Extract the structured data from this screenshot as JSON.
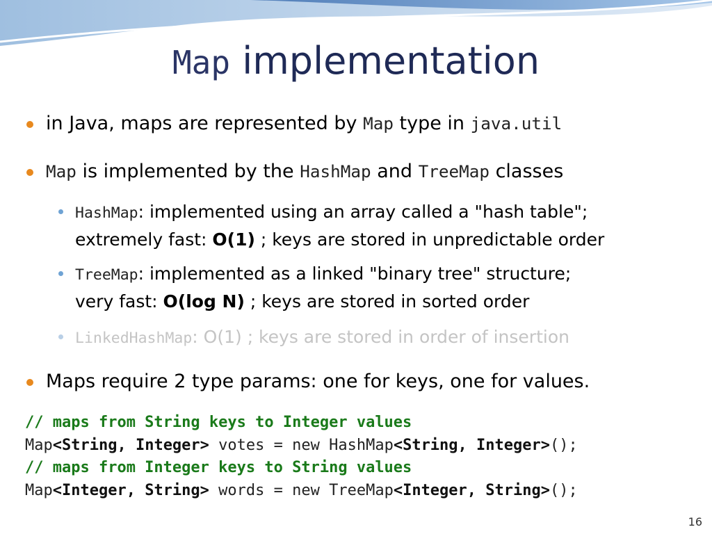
{
  "title": {
    "mono": "Map",
    "text": " implementation"
  },
  "bullets": [
    {
      "t1": "in Java, maps are represented by ",
      "c1": "Map",
      "t2": " type in ",
      "c2": "java.util"
    },
    {
      "c1": "Map",
      "t1": " is implemented by the ",
      "c2": "HashMap",
      "t2": " and ",
      "c3": "TreeMap",
      "t3": " classes"
    }
  ],
  "sub": [
    {
      "code": "HashMap",
      "text1": ": implemented using an array called a \"hash table\";",
      "text2": "extremely fast: ",
      "bold": "O(1)",
      "text3": " ; keys are stored in unpredictable order"
    },
    {
      "code": "TreeMap",
      "text1": ": implemented as a linked \"binary tree\" structure;",
      "text2": "very fast: ",
      "bold": "O(log N)",
      "text3": " ; keys are stored in sorted order"
    },
    {
      "code": "LinkedHashMap",
      "text1": ": O(1) ; keys are stored in order of insertion"
    }
  ],
  "bullet3": "Maps require 2 type params: one for keys, one for values.",
  "code": {
    "comment1": "// maps from String keys to Integer values",
    "line1": {
      "a": "Map",
      "b": "<String, Integer>",
      "c": " votes = new HashMap",
      "d": "<String, Integer>",
      "e": "();"
    },
    "comment2": "// maps from Integer keys to String values",
    "line2": {
      "a": "Map",
      "b": "<Integer, String>",
      "c": " words = new TreeMap",
      "d": "<Integer, String>",
      "e": "();"
    }
  },
  "page_number": "16",
  "colors": {
    "title": "#1f2a56",
    "bullet": "#e8891e",
    "sub_bullet": "#6fa3d4",
    "comment": "#1a7a1a"
  }
}
